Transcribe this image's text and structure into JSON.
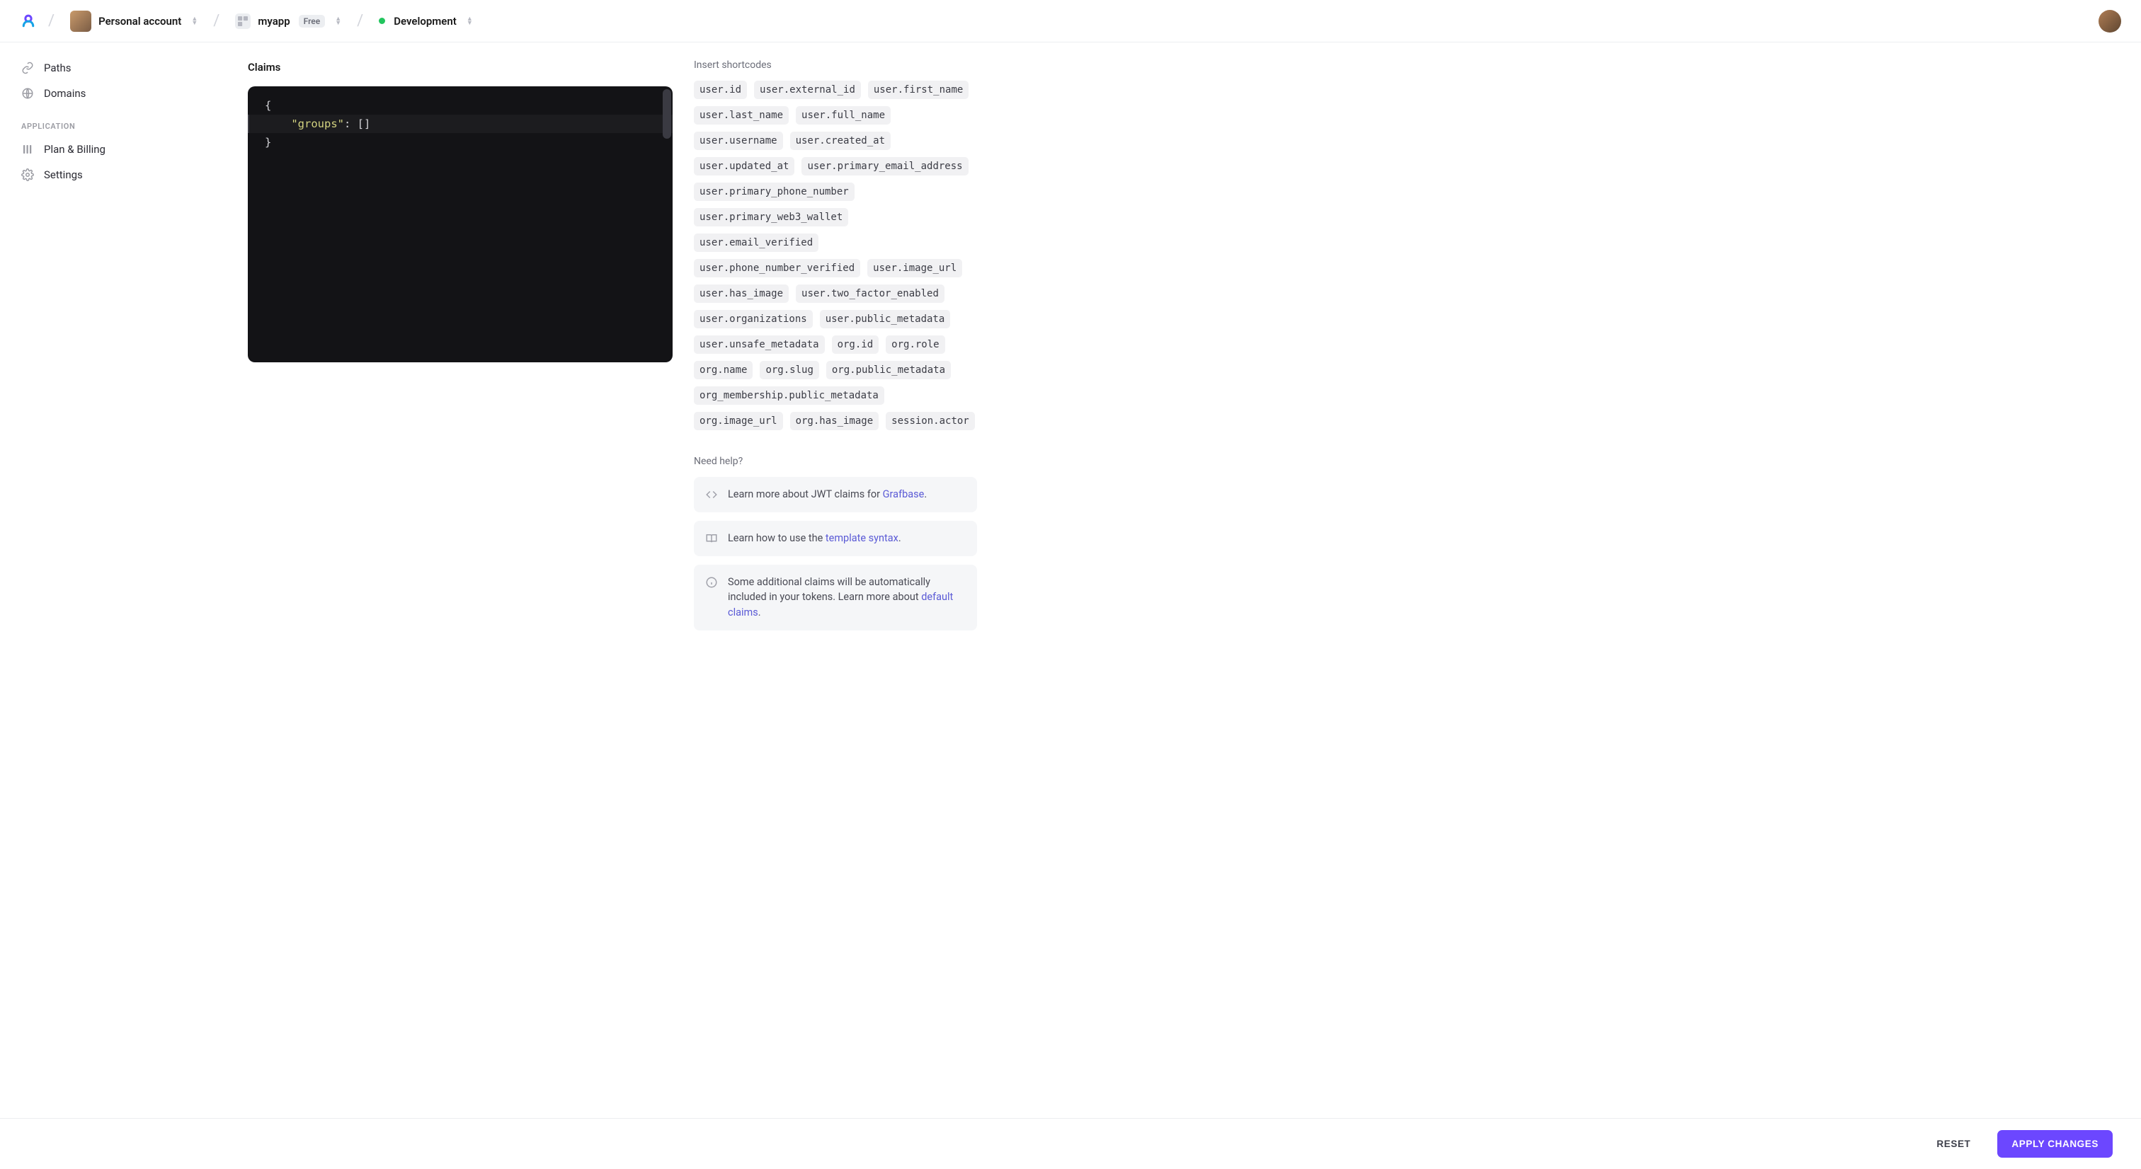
{
  "header": {
    "account_label": "Personal account",
    "app_name": "myapp",
    "plan_tag": "Free",
    "environment": "Development"
  },
  "sidebar": {
    "items": [
      {
        "label": "Paths",
        "icon": "link"
      },
      {
        "label": "Domains",
        "icon": "globe"
      }
    ],
    "section_label": "APPLICATION",
    "app_items": [
      {
        "label": "Plan & Billing",
        "icon": "billing"
      },
      {
        "label": "Settings",
        "icon": "gear"
      }
    ]
  },
  "claims": {
    "title": "Claims",
    "code": {
      "l1": "{",
      "key": "\"groups\"",
      "after_key": ": []",
      "l3": "}"
    }
  },
  "shortcodes": {
    "title": "Insert shortcodes",
    "items": [
      "user.id",
      "user.external_id",
      "user.first_name",
      "user.last_name",
      "user.full_name",
      "user.username",
      "user.created_at",
      "user.updated_at",
      "user.primary_email_address",
      "user.primary_phone_number",
      "user.primary_web3_wallet",
      "user.email_verified",
      "user.phone_number_verified",
      "user.image_url",
      "user.has_image",
      "user.two_factor_enabled",
      "user.organizations",
      "user.public_metadata",
      "user.unsafe_metadata",
      "org.id",
      "org.role",
      "org.name",
      "org.slug",
      "org.public_metadata",
      "org_membership.public_metadata",
      "org.image_url",
      "org.has_image",
      "session.actor"
    ]
  },
  "help": {
    "title": "Need help?",
    "card1_pre": "Learn more about JWT claims for ",
    "card1_link": "Grafbase",
    "card1_post": ".",
    "card2_pre": "Learn how to use the ",
    "card2_link": "template syntax",
    "card2_post": ".",
    "card3_pre": "Some additional claims will be automatically included in your tokens. Learn more about ",
    "card3_link": "default claims",
    "card3_post": "."
  },
  "actions": {
    "reset": "RESET",
    "apply": "APPLY CHANGES"
  }
}
